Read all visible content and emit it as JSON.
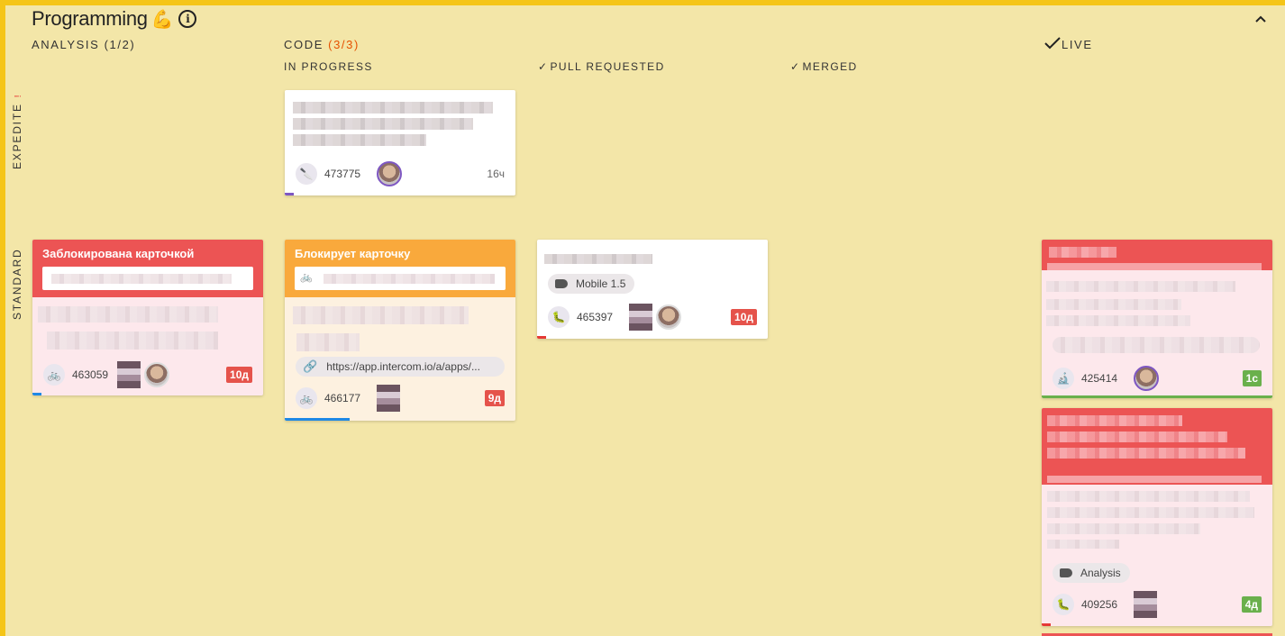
{
  "board": {
    "title": "Programming",
    "title_emoji": "💪",
    "info_icon": "i",
    "collapse_icon": "^"
  },
  "columns": {
    "analysis": {
      "label": "ANALYSIS (1/2)"
    },
    "code": {
      "label": "CODE ",
      "count": "(3/3)"
    },
    "live": {
      "label": "LIVE"
    }
  },
  "subcolumns": {
    "in_progress": "IN PROGRESS",
    "pull_requested": "PULL REQUESTED",
    "merged": "MERGED"
  },
  "lanes": {
    "expedite": "EXPEDITE",
    "expedite_mark": "!",
    "standard": "STANDARD"
  },
  "icons": {
    "check": "✓",
    "bicycle": "🚲",
    "knife": "🔪",
    "microscope": "🔬",
    "caterpillar": "🐛",
    "link": "🔗"
  },
  "cards": {
    "expedite_code": {
      "id": "473775",
      "age": "16ч"
    },
    "blocked": {
      "header": "Заблокирована карточкой",
      "id": "463059",
      "age": "10д"
    },
    "blocking": {
      "header": "Блокирует карточку",
      "link": "https://app.intercom.io/a/apps/...",
      "id": "466177",
      "age": "9д"
    },
    "pr": {
      "tag": "Mobile 1.5",
      "id": "465397",
      "age": "10д"
    },
    "live1": {
      "id": "425414",
      "age": "1с"
    },
    "live2": {
      "tag": "Analysis",
      "id": "409256",
      "age": "4д"
    }
  },
  "colors": {
    "frame": "#f5c518",
    "background": "#f3e6a8",
    "blocked_header": "#ec5454",
    "blocking_header": "#f9a93c",
    "count_accent": "#e65100",
    "overdue_badge": "#e5534b",
    "fresh_badge": "#6ab04c"
  }
}
